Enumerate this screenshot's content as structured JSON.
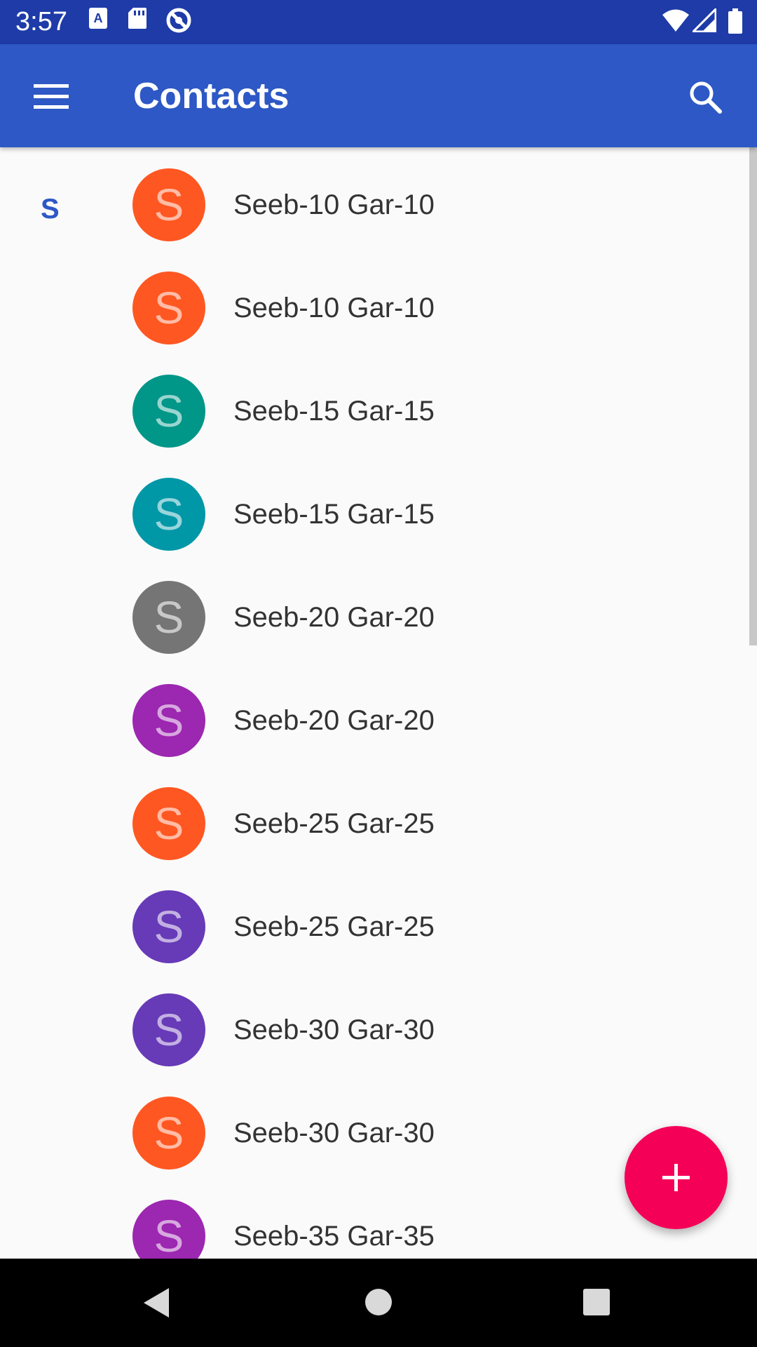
{
  "status_bar": {
    "time": "3:57",
    "left_icons": [
      "a-notification-icon",
      "sd-card-icon",
      "sync-icon"
    ],
    "right_icons": [
      "wifi-icon",
      "cell-signal-icon",
      "battery-icon"
    ]
  },
  "app_bar": {
    "title": "Contacts",
    "menu_icon": "hamburger-menu-icon",
    "search_icon": "search-icon"
  },
  "section": {
    "letter": "S"
  },
  "contacts": [
    {
      "initial": "S",
      "name": "Seeb-10 Gar-10",
      "color": "#ff5722"
    },
    {
      "initial": "S",
      "name": "Seeb-10 Gar-10",
      "color": "#ff5722"
    },
    {
      "initial": "S",
      "name": "Seeb-15 Gar-15",
      "color": "#009688"
    },
    {
      "initial": "S",
      "name": "Seeb-15 Gar-15",
      "color": "#0097a7"
    },
    {
      "initial": "S",
      "name": "Seeb-20 Gar-20",
      "color": "#757575"
    },
    {
      "initial": "S",
      "name": "Seeb-20 Gar-20",
      "color": "#9c27b0"
    },
    {
      "initial": "S",
      "name": "Seeb-25 Gar-25",
      "color": "#ff5722"
    },
    {
      "initial": "S",
      "name": "Seeb-25 Gar-25",
      "color": "#673ab7"
    },
    {
      "initial": "S",
      "name": "Seeb-30 Gar-30",
      "color": "#673ab7"
    },
    {
      "initial": "S",
      "name": "Seeb-30 Gar-30",
      "color": "#ff5722"
    },
    {
      "initial": "S",
      "name": "Seeb-35 Gar-35",
      "color": "#9c27b0"
    }
  ],
  "fab": {
    "icon": "plus-icon",
    "color": "#f50057"
  },
  "nav_bar": {
    "icons": [
      "back-icon",
      "home-icon",
      "recents-icon"
    ]
  },
  "colors": {
    "status_bar": "#1e3ba8",
    "app_bar": "#2d58c5",
    "background": "#fafafa"
  }
}
